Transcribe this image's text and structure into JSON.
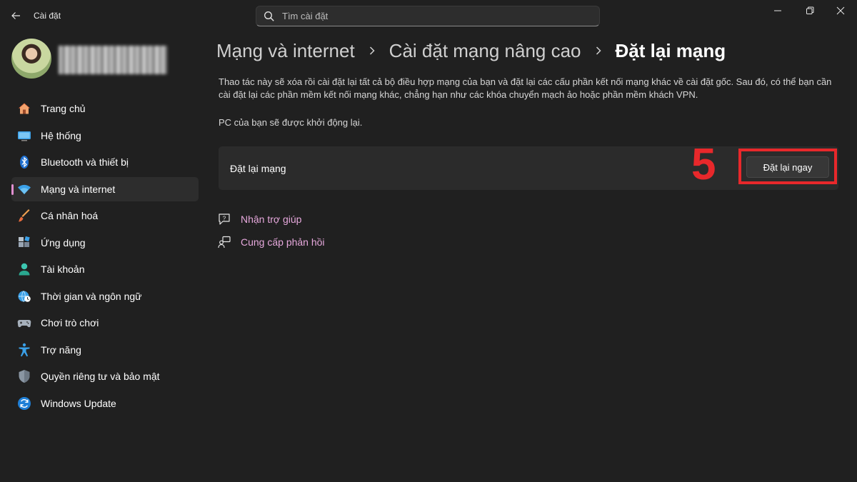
{
  "window": {
    "title": "Cài đặt",
    "controls": [
      "minimize-icon",
      "restore-icon",
      "close-icon"
    ]
  },
  "search": {
    "placeholder": "Tìm cài đặt"
  },
  "sidebar": {
    "items": [
      {
        "label": "Trang chủ",
        "icon": "home-icon"
      },
      {
        "label": "Hệ thống",
        "icon": "monitor-icon"
      },
      {
        "label": "Bluetooth và thiết bị",
        "icon": "bluetooth-icon"
      },
      {
        "label": "Mạng và internet",
        "icon": "wifi-icon",
        "active": true
      },
      {
        "label": "Cá nhân hoá",
        "icon": "brush-icon"
      },
      {
        "label": "Ứng dụng",
        "icon": "apps-icon"
      },
      {
        "label": "Tài khoản",
        "icon": "person-icon"
      },
      {
        "label": "Thời gian và ngôn ngữ",
        "icon": "globe-clock-icon"
      },
      {
        "label": "Chơi trò chơi",
        "icon": "gamepad-icon"
      },
      {
        "label": "Trợ năng",
        "icon": "accessibility-icon"
      },
      {
        "label": "Quyền riêng tư và bảo mật",
        "icon": "shield-icon"
      },
      {
        "label": "Windows Update",
        "icon": "update-icon"
      }
    ]
  },
  "breadcrumb": {
    "items": [
      "Mạng và internet",
      "Cài đặt mạng nâng cao"
    ],
    "current": "Đặt lại mạng"
  },
  "main": {
    "description": "Thao tác này sẽ xóa rồi cài đặt lại tất cả bộ điều hợp mạng của bạn và đặt lại các cấu phần kết nối mạng khác về cài đặt gốc. Sau đó, có thể bạn cần cài đặt lại các phần mềm kết nối mạng khác, chẳng hạn như các khóa chuyển mạch ảo hoặc phần mềm khách VPN.",
    "restart_note": "PC của bạn sẽ được khởi động lại.",
    "card": {
      "label": "Đặt lại mạng",
      "button": "Đặt lại ngay",
      "step_number": "5"
    },
    "links": [
      {
        "label": "Nhận trợ giúp",
        "icon": "help-chat-icon"
      },
      {
        "label": "Cung cấp phản hồi",
        "icon": "feedback-icon"
      }
    ]
  },
  "colors": {
    "background": "#202020",
    "card": "#2b2b2b",
    "accent_link": "#e6a8dc",
    "annotation_red": "#e8282b"
  }
}
